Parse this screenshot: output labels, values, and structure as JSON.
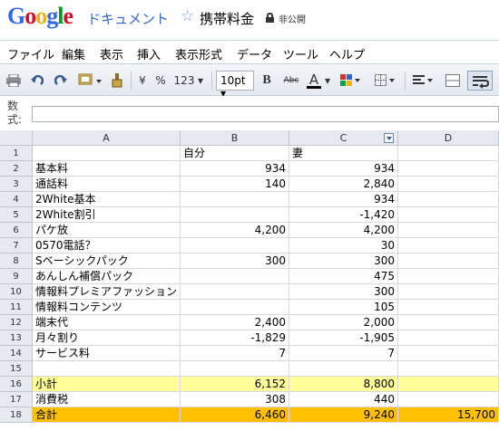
{
  "app": {
    "logo": [
      "G",
      "o",
      "o",
      "g",
      "l",
      "e"
    ],
    "product": "ドキュメント",
    "doc_title": "携帯料金",
    "privacy": "非公開"
  },
  "menu": [
    "ファイル",
    "編集",
    "表示",
    "挿入",
    "表示形式",
    "データ",
    "ツール",
    "ヘルプ"
  ],
  "toolbar": {
    "currency": "¥",
    "percent": "%",
    "number_format": "123",
    "font_size": "10pt",
    "bold": "B",
    "strikethrough": "Abc",
    "text_color": "A"
  },
  "formula_bar": {
    "label": "数式:",
    "value": ""
  },
  "columns": [
    "A",
    "B",
    "C",
    "D"
  ],
  "rows": [
    {
      "n": "1",
      "a": "",
      "b": "自分",
      "c": "妻",
      "d": ""
    },
    {
      "n": "2",
      "a": "基本料",
      "b": "934",
      "c": "934",
      "d": ""
    },
    {
      "n": "3",
      "a": "通話料",
      "b": "140",
      "c": "2,840",
      "d": ""
    },
    {
      "n": "4",
      "a": "2White基本",
      "b": "",
      "c": "934",
      "d": ""
    },
    {
      "n": "5",
      "a": "2White割引",
      "b": "",
      "c": "-1,420",
      "d": ""
    },
    {
      "n": "6",
      "a": "パケ放",
      "b": "4,200",
      "c": "4,200",
      "d": ""
    },
    {
      "n": "7",
      "a": "0570電話？",
      "b": "",
      "c": "30",
      "d": ""
    },
    {
      "n": "8",
      "a": "Sベーシックパック",
      "b": "300",
      "c": "300",
      "d": ""
    },
    {
      "n": "9",
      "a": "あんしん補償パック",
      "b": "",
      "c": "475",
      "d": ""
    },
    {
      "n": "10",
      "a": "情報料プレミアファッション",
      "b": "",
      "c": "300",
      "d": ""
    },
    {
      "n": "11",
      "a": "情報料コンテンツ",
      "b": "",
      "c": "105",
      "d": ""
    },
    {
      "n": "12",
      "a": "端末代",
      "b": "2,400",
      "c": "2,000",
      "d": ""
    },
    {
      "n": "13",
      "a": "月々割り",
      "b": "-1,829",
      "c": "-1,905",
      "d": ""
    },
    {
      "n": "14",
      "a": "サービス料",
      "b": "7",
      "c": "7",
      "d": ""
    },
    {
      "n": "15",
      "a": "",
      "b": "",
      "c": "",
      "d": ""
    },
    {
      "n": "16",
      "a": "小計",
      "b": "6,152",
      "c": "8,800",
      "d": ""
    },
    {
      "n": "17",
      "a": "消費税",
      "b": "308",
      "c": "440",
      "d": ""
    },
    {
      "n": "18",
      "a": "合計",
      "b": "6,460",
      "c": "9,240",
      "d": "15,700"
    }
  ],
  "colors": {
    "subtotal_bg": "#ffff99",
    "total_bg": "#ffc000"
  }
}
